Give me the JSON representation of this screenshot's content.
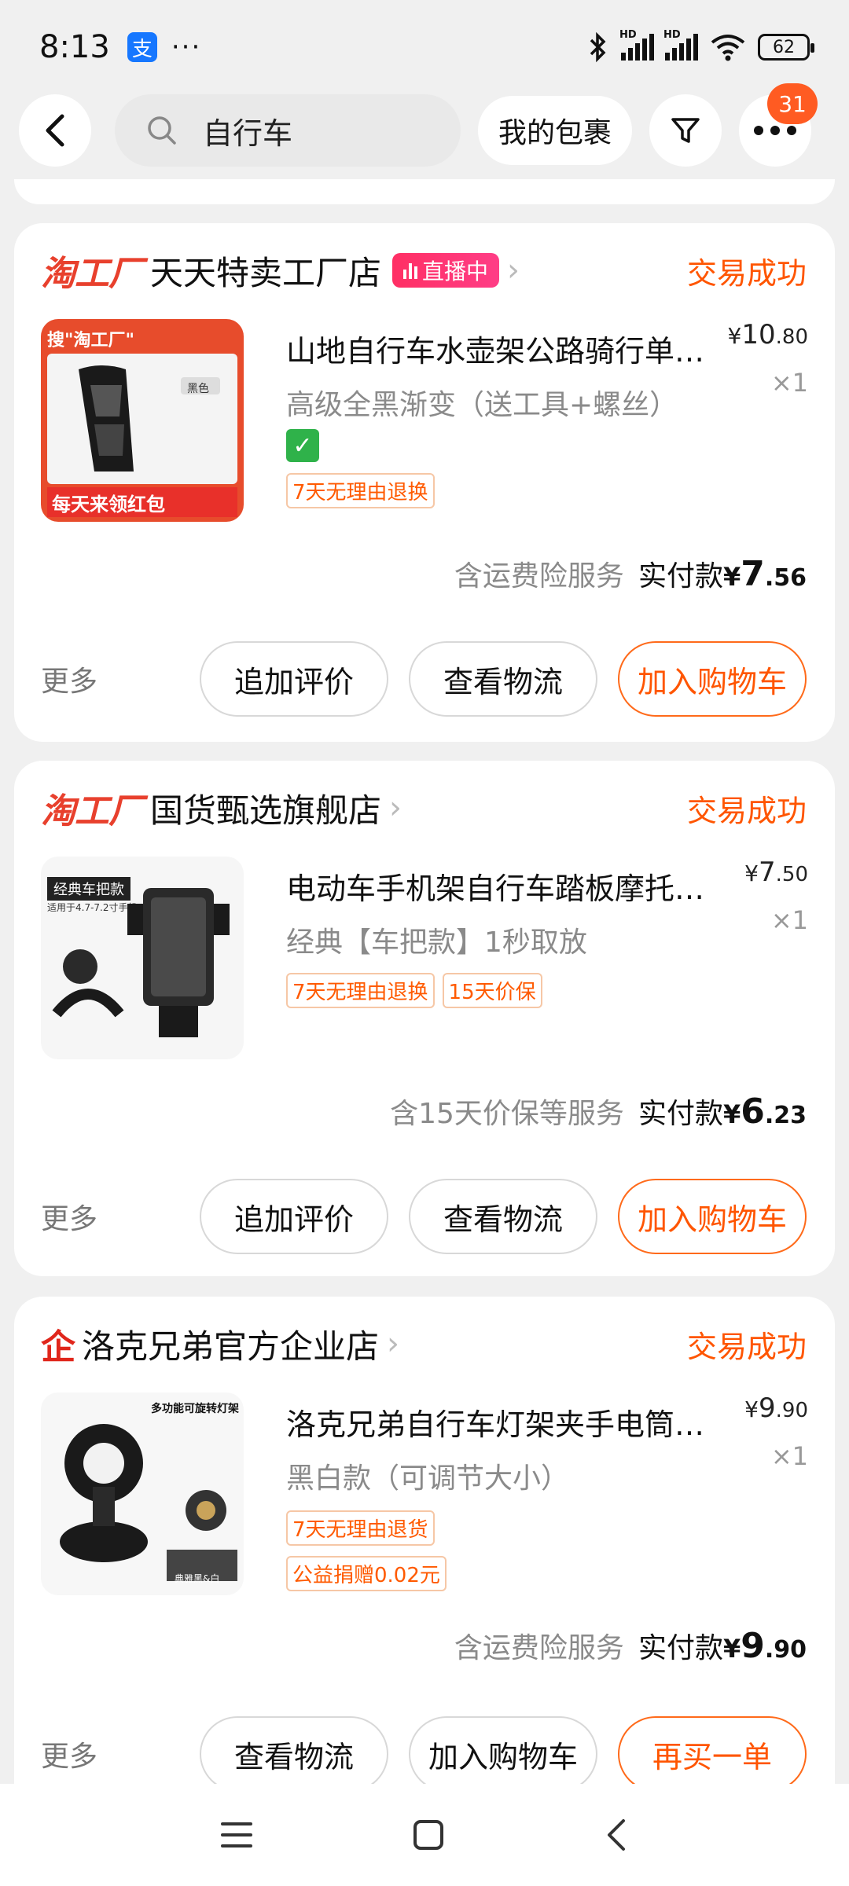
{
  "status_bar": {
    "time": "8:13",
    "app_icon": "支",
    "dots": "···",
    "battery": "62"
  },
  "nav": {
    "search_query": "自行车",
    "packages_label": "我的包裹",
    "notification_count": "31"
  },
  "orders": [
    {
      "shop_prefix": "淘工厂",
      "shop_name": "天天特卖工厂店",
      "live_badge": "直播中",
      "status": "交易成功",
      "product_title": "山地自行车水壶架公路骑行单…",
      "spec": "高级全黑渐变（送工具+螺丝）",
      "price_int": "10",
      "price_dec": ".80",
      "qty": "×1",
      "tags": [
        "7天无理由退换"
      ],
      "pay_note": "含运费险服务",
      "pay_label": "实付款",
      "pay_int": "7",
      "pay_dec": ".56",
      "more": "更多",
      "buttons": [
        "追加评价",
        "查看物流",
        "加入购物车"
      ],
      "thumb_text": [
        "搜\"淘工厂\"",
        "黑色",
        "每天来领红包"
      ]
    },
    {
      "shop_prefix": "淘工厂",
      "shop_name": "国货甄选旗舰店",
      "status": "交易成功",
      "product_title": "电动车手机架自行车踏板摩托…",
      "spec": "经典【车把款】1秒取放",
      "price_int": "7",
      "price_dec": ".50",
      "qty": "×1",
      "tags": [
        "7天无理由退换",
        "15天价保"
      ],
      "pay_note": "含15天价保等服务",
      "pay_label": "实付款",
      "pay_int": "6",
      "pay_dec": ".23",
      "more": "更多",
      "buttons": [
        "追加评价",
        "查看物流",
        "加入购物车"
      ],
      "thumb_text": [
        "经典车把款",
        "适用于4.7-7.2寸手机"
      ]
    },
    {
      "shop_prefix": "企",
      "shop_name": "洛克兄弟官方企业店",
      "status": "交易成功",
      "product_title": "洛克兄弟自行车灯架夹手电筒…",
      "spec": "黑白款（可调节大小）",
      "price_int": "9",
      "price_dec": ".90",
      "qty": "×1",
      "tags": [
        "7天无理由退货",
        "公益捐赠0.02元"
      ],
      "pay_note": "含运费险服务",
      "pay_label": "实付款",
      "pay_int": "9",
      "pay_dec": ".90",
      "more": "更多",
      "buttons": [
        "查看物流",
        "加入购物车",
        "再买一单"
      ],
      "thumb_text": [
        "多功能可旋转灯架",
        "典雅黑&白"
      ]
    }
  ],
  "colors": {
    "accent": "#ff5500",
    "brand_red": "#e8402d",
    "tag_border": "#f6c7a6",
    "background": "#f0f0f0"
  }
}
